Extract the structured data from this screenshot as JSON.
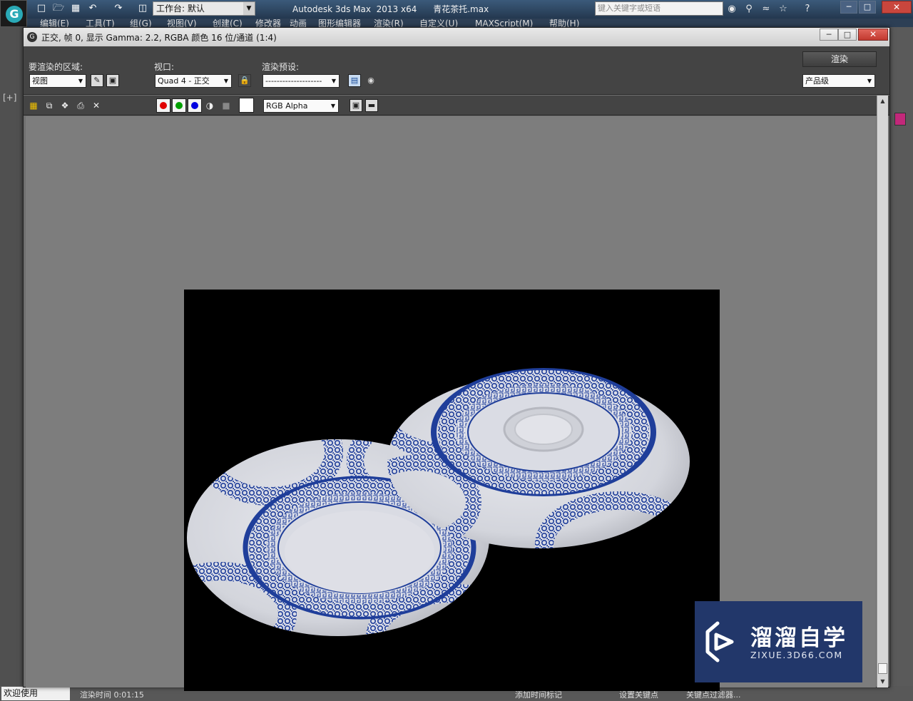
{
  "host_app": {
    "title": "Autodesk 3ds Max  2013 x64      青花茶托.max",
    "workspace": "工作台: 默认",
    "search_placeholder": "键入关键字或短语",
    "menus": [
      "编辑(E)",
      "工具(T)",
      "组(G)",
      "视图(V)",
      "创建(C)",
      "修改器",
      "动画",
      "图形编辑器",
      "渲染(R)",
      "自定义(U)",
      "MAXScript(M)",
      "帮助(H)"
    ],
    "viewport_label": "[+]",
    "status": {
      "welcome": "欢迎使用",
      "render_time": "渲染时间  0:01:15",
      "add_time_tag": "添加时间标记",
      "set_key": "设置关键点",
      "key_filter": "关键点过滤器..."
    }
  },
  "render_window": {
    "title": "正交, 帧 0, 显示 Gamma: 2.2, RGBA 颜色 16 位/通道 (1:4)",
    "area_label": "要渲染的区域:",
    "area_value": "视图",
    "viewport_label": "视口:",
    "viewport_value": "Quad 4 - 正交",
    "preset_label": "渲染预设:",
    "preset_value": "--------------------",
    "render_button": "渲染",
    "quality_value": "产品级",
    "channel_value": "RGB Alpha",
    "channel_colors": {
      "red": "#e00000",
      "green": "#00a000",
      "blue": "#0000e0"
    }
  },
  "render_image": {
    "background": "#000000",
    "porcelain_color": "#dcdde3",
    "pattern_color": "#1f3e9a"
  },
  "watermark": {
    "title": "溜溜自学",
    "url": "ZIXUE.3D66.COM"
  },
  "icons": [
    "max-logo-icon",
    "new-icon",
    "open-icon",
    "save-icon",
    "undo-icon",
    "redo-icon",
    "binoculars-icon",
    "key-icon",
    "star-icon",
    "help-icon",
    "lock-icon",
    "save-image-icon",
    "copy-image-icon",
    "clone-window-icon",
    "print-icon",
    "clear-icon",
    "monochrome-icon",
    "alpha-icon"
  ]
}
